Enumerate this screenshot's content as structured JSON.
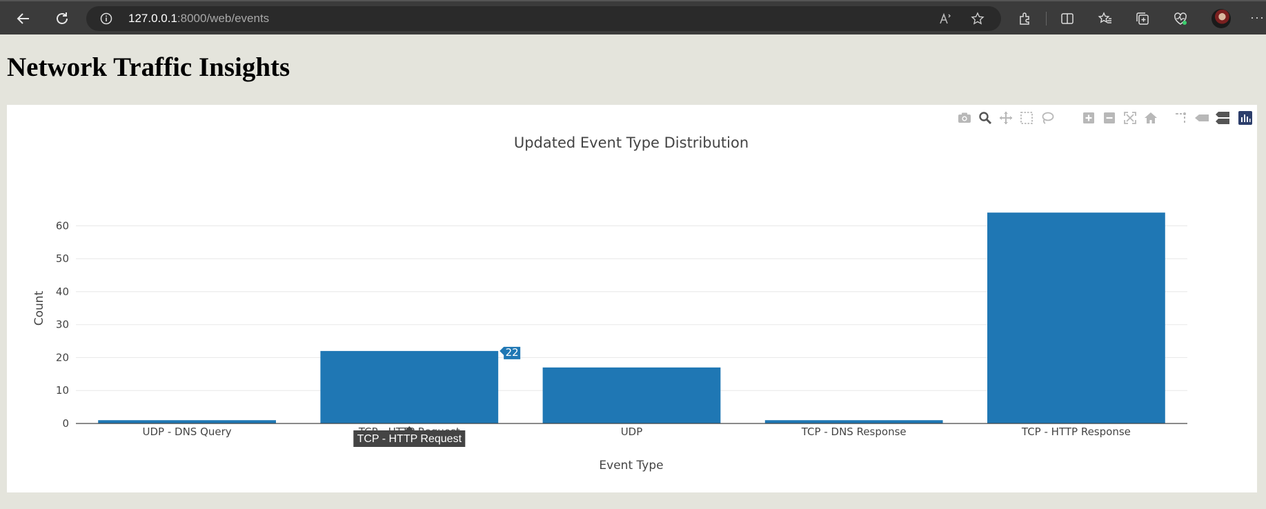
{
  "browser": {
    "url_host": "127.0.0.1",
    "url_rest": ":8000/web/events",
    "icons": [
      "back-icon",
      "refresh-icon",
      "site-info-icon",
      "read-aloud-icon",
      "favorite-star-icon",
      "extensions-icon",
      "split-screen-icon",
      "favorites-icon",
      "collections-icon",
      "browser-essentials-icon",
      "profile-avatar",
      "more-icon"
    ]
  },
  "page": {
    "title": "Network Traffic Insights"
  },
  "modebar": {
    "icons": [
      "camera-icon",
      "zoom-icon",
      "pan-icon",
      "box-select-icon",
      "lasso-select-icon",
      "zoom-in-icon",
      "zoom-out-icon",
      "autoscale-icon",
      "reset-axes-icon",
      "spike-lines-icon",
      "hover-closest-icon",
      "hover-compare-icon",
      "plotly-logo-icon"
    ]
  },
  "chart_data": {
    "type": "bar",
    "title": "Updated Event Type Distribution",
    "xlabel": "Event Type",
    "ylabel": "Count",
    "categories": [
      "UDP - DNS Query",
      "TCP - HTTP Request",
      "UDP",
      "TCP - DNS Response",
      "TCP - HTTP Response"
    ],
    "values": [
      1,
      22,
      17,
      1,
      64
    ],
    "ylim": [
      0,
      67.4
    ],
    "yticks": [
      0,
      10,
      20,
      30,
      40,
      50,
      60
    ],
    "grid": true,
    "bar_color": "#1f77b4",
    "hover": {
      "category_index": 1,
      "value_label": "22",
      "category_label": "TCP - HTTP Request"
    }
  }
}
